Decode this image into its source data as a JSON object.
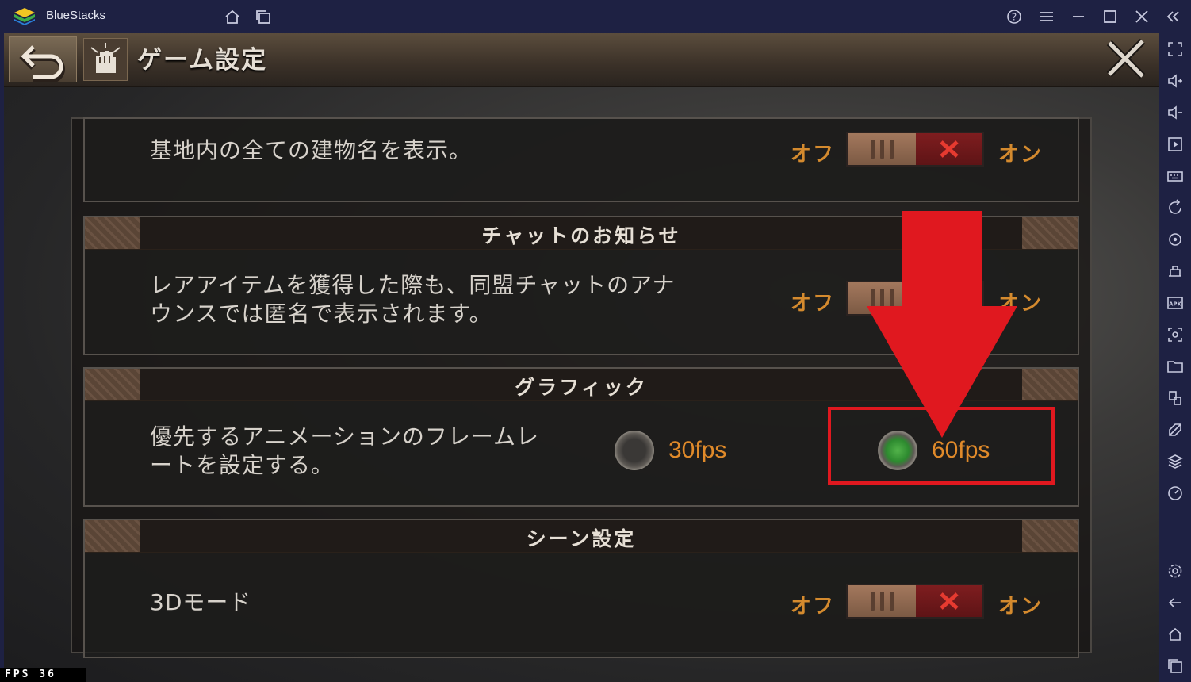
{
  "window": {
    "app_title": "BlueStacks",
    "titlebar_icons": [
      "home-icon",
      "multi-instance-icon",
      "help-icon",
      "menu-icon",
      "minimize-icon",
      "maximize-icon",
      "close-icon",
      "collapse-sidebar-icon"
    ]
  },
  "sidebar": {
    "icons": [
      "fullscreen-icon",
      "volume-up-icon",
      "volume-down-icon",
      "media-icon",
      "keyboard-icon",
      "rotate-icon",
      "sync-icon",
      "macro-icon",
      "apk-icon",
      "screenshot-icon",
      "folder-icon",
      "multi-instance-icon",
      "eco-mode-icon",
      "layers-icon",
      "performance-icon",
      "settings-icon",
      "back-icon",
      "home-icon",
      "recent-apps-icon"
    ]
  },
  "game": {
    "header": {
      "title": "ゲーム設定"
    },
    "rows": {
      "building_names": {
        "text": "基地内の全ての建物名を表示。",
        "off_label": "オフ",
        "on_label": "オン"
      },
      "chat_notice": {
        "section_title": "チャットのお知らせ",
        "text_line1": "レアアイテムを獲得した際も、同盟チャットのアナ",
        "text_line2": "ウンスでは匿名で表示されます。",
        "off_label": "オフ",
        "on_label": "オン"
      },
      "graphics": {
        "section_title": "グラフィック",
        "text_line1": "優先するアニメーションのフレームレ",
        "text_line2": "ートを設定する。",
        "option_30": "30fps",
        "option_60": "60fps",
        "selected": "60fps"
      },
      "scene": {
        "section_title": "シーン設定",
        "text": "3Dモード",
        "off_label": "オフ",
        "on_label": "オン"
      }
    }
  },
  "overlay": {
    "fps_counter": "FPS  36",
    "annotation_color": "#e0181f"
  }
}
